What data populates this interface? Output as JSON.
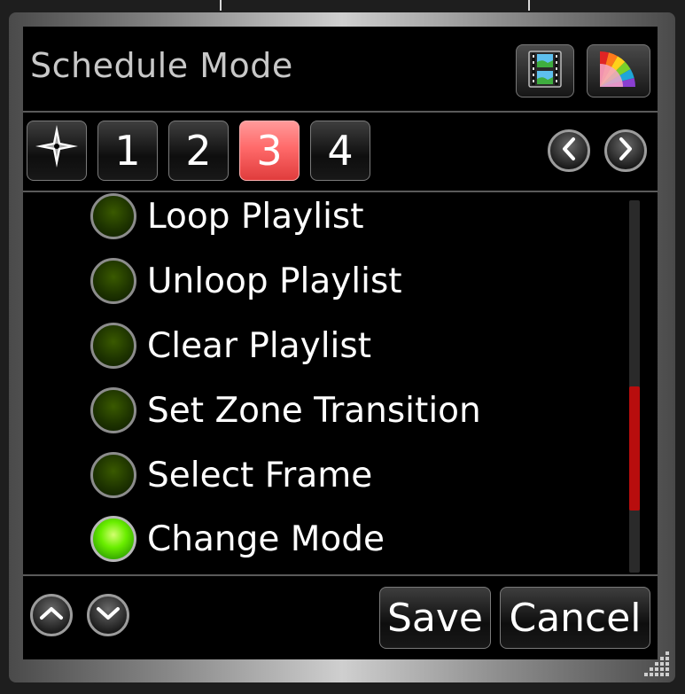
{
  "dialog": {
    "title": "Schedule Mode",
    "toolbar": {
      "media_icon": "film-image-icon",
      "color_icon": "color-fan-icon"
    }
  },
  "tabs": {
    "home_icon": "compass-star-icon",
    "items": [
      "1",
      "2",
      "3",
      "4"
    ],
    "selected": "3",
    "prev_icon": "chevron-left-icon",
    "next_icon": "chevron-right-icon"
  },
  "list": {
    "items": [
      {
        "label": "Loop Playlist",
        "state": "off"
      },
      {
        "label": "Unloop Playlist",
        "state": "off"
      },
      {
        "label": "Clear Playlist",
        "state": "off"
      },
      {
        "label": "Set Zone Transition",
        "state": "off"
      },
      {
        "label": "Select Frame",
        "state": "off"
      },
      {
        "label": "Change Mode",
        "state": "on"
      }
    ],
    "scroll_position": 0.75
  },
  "footer": {
    "up_icon": "chevron-up-icon",
    "down_icon": "chevron-down-icon",
    "save_label": "Save",
    "cancel_label": "Cancel"
  },
  "colors": {
    "active_tab": "#ff6a6a",
    "led_on": "#6aee00",
    "led_off": "#1e3400",
    "scroll_thumb": "#b80d0d"
  }
}
